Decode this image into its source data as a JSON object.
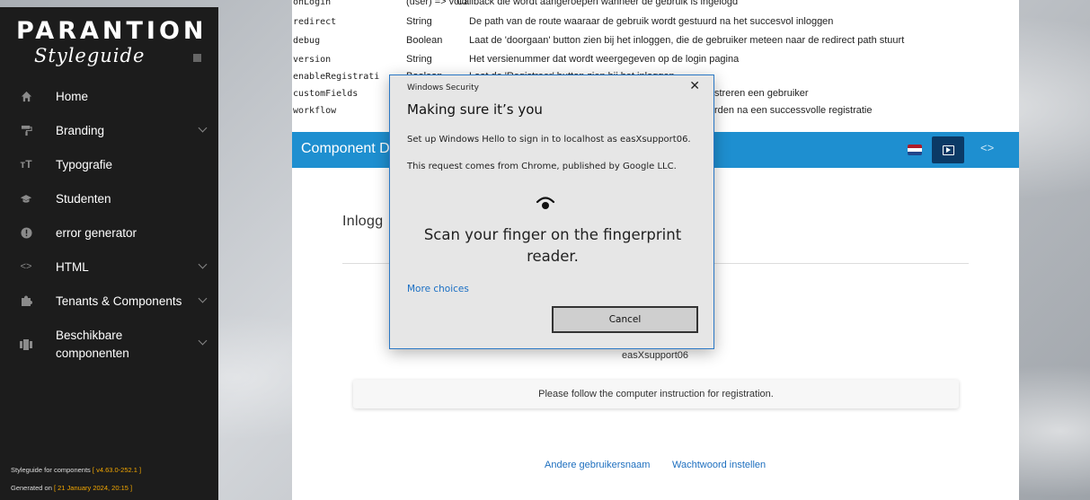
{
  "sidebar": {
    "logo_main": "PARANTION",
    "logo_sub": "Styleguide",
    "items": [
      {
        "label": "Home",
        "icon": "home-icon",
        "has_submenu": false
      },
      {
        "label": "Branding",
        "icon": "paint-roller-icon",
        "has_submenu": true
      },
      {
        "label": "Typografie",
        "icon": "text-height-icon",
        "has_submenu": false
      },
      {
        "label": "Studenten",
        "icon": "graduation-cap-icon",
        "has_submenu": false
      },
      {
        "label": "error generator",
        "icon": "exclamation-circle-icon",
        "has_submenu": false
      },
      {
        "label": "HTML",
        "icon": "code-icon",
        "has_submenu": true
      },
      {
        "label": "Tenants & Components",
        "icon": "puzzle-icon",
        "has_submenu": true
      },
      {
        "label": "Beschikbare componenten",
        "icon": "columns-icon",
        "has_submenu": true
      }
    ],
    "footer": {
      "line1_prefix": "Styleguide for components",
      "line1_version": "[ v4.63.0-252.1 ]",
      "line2_prefix": "Generated on",
      "line2_date": "[ 21 January 2024, 20:15 ]"
    }
  },
  "params": [
    {
      "name": "onLogin",
      "type": "(user) => void",
      "desc": "Callback die wordt aangeroepen wanneer de gebruik is ingelogd"
    },
    {
      "name": "redirect",
      "type": "String",
      "desc": "De path van de route waaraar de gebruik wordt gestuurd na het succesvol inloggen"
    },
    {
      "name": "debug",
      "type": "Boolean",
      "desc": "Laat de 'doorgaan' button zien bij het inloggen, die de gebruiker meteen naar de redirect path stuurt"
    },
    {
      "name": "version",
      "type": "String",
      "desc": "Het versienummer dat wordt weergegeven op de login pagina"
    },
    {
      "name": "enableRegistrati",
      "type": "Boolean",
      "desc": "Laat de 'Registreer' button zien bij het inloggen"
    },
    {
      "name": "customFields",
      "type": "",
      "desc": "streren een gebruiker"
    },
    {
      "name": "workflow",
      "type": "",
      "desc": "rden na een successvolle registratie"
    }
  ],
  "component_bar": {
    "title": "Component D",
    "code_toggle": "<>",
    "colors": {
      "bar": "#1e8fd0",
      "preview_button": "#0b3a66"
    },
    "flag_colors": [
      "#ae1c28",
      "#ffffff",
      "#21468b"
    ]
  },
  "login": {
    "heading": "Inlogg",
    "username": "easXsupport06",
    "notice": "Please follow the computer instruction for registration.",
    "link_other_user": "Andere gebruikersnaam",
    "link_password": "Wachtwoord instellen"
  },
  "dialog": {
    "caption": "Windows Security",
    "close": "✕",
    "title": "Making sure it’s you",
    "line1": "Set up Windows Hello to sign in to localhost as easXsupport06.",
    "line2": "This request comes from Chrome, published by Google LLC.",
    "icon": "fingerprint-icon",
    "scan_text": "Scan your finger on the fingerprint reader.",
    "more_choices": "More choices",
    "cancel": "Cancel"
  }
}
